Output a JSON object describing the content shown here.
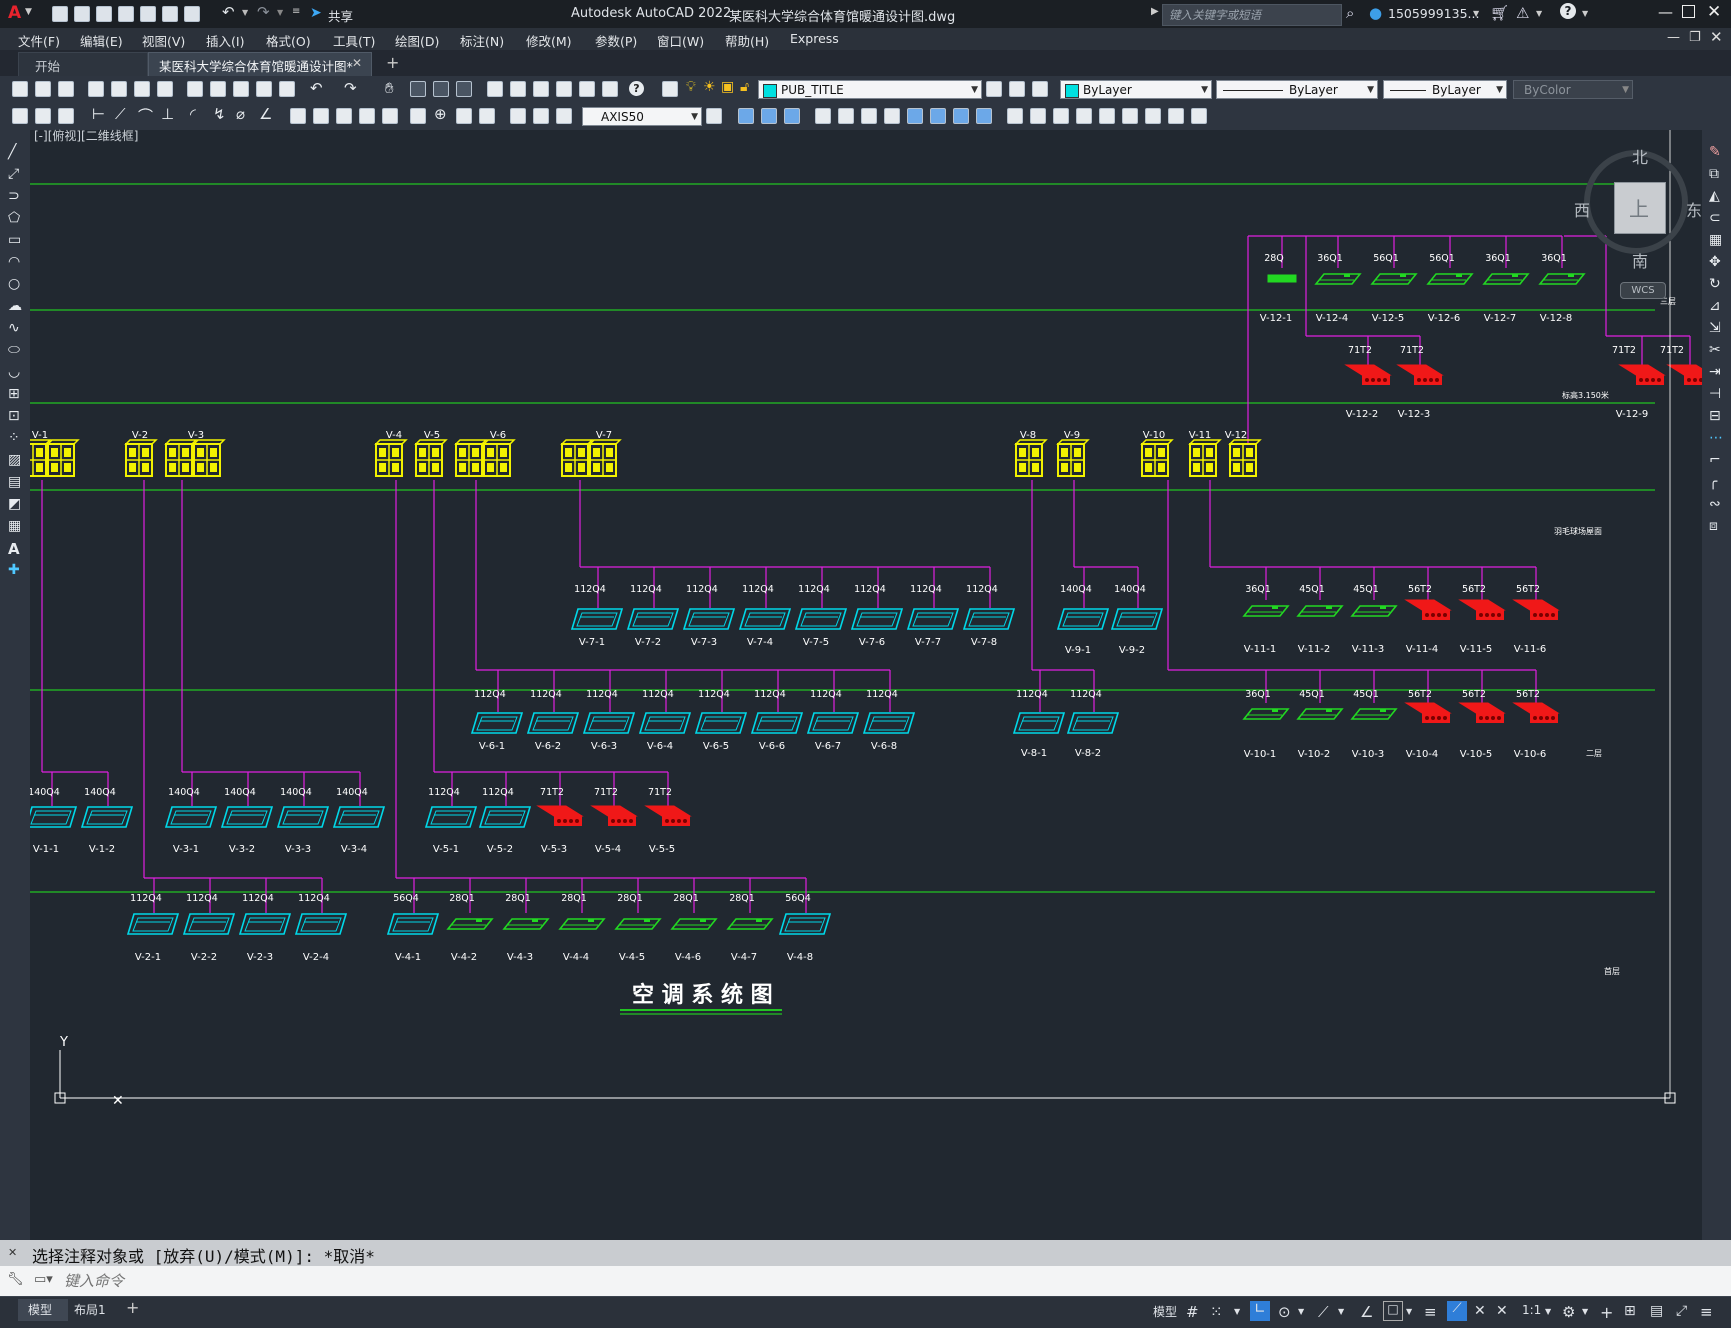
{
  "app": {
    "title": "Autodesk AutoCAD 2022",
    "file": "某医科大学综合体育馆暖通设计图.dwg",
    "share": "共享",
    "search_placeholder": "键入关键字或短语",
    "user": "1505999135...",
    "logo": "A"
  },
  "menu": [
    "文件(F)",
    "编辑(E)",
    "视图(V)",
    "插入(I)",
    "格式(O)",
    "工具(T)",
    "绘图(D)",
    "标注(N)",
    "修改(M)",
    "参数(P)",
    "窗口(W)",
    "帮助(H)",
    "Express"
  ],
  "tabs": [
    {
      "label": "开始",
      "active": false
    },
    {
      "label": "某医科大学综合体育馆暖通设计图*",
      "active": true
    }
  ],
  "toolbar": {
    "layer": "PUB_TITLE",
    "color": "ByLayer",
    "linetype": "ByLayer",
    "lineweight": "ByLayer",
    "plotstyle": "ByColor",
    "dimstyle": "AXIS50"
  },
  "viewport_label": "[-][俯视][二维线框]",
  "viewcube": {
    "north": "北",
    "south": "南",
    "east": "东",
    "west": "西",
    "top": "上",
    "wcs": "WCS"
  },
  "drawing": {
    "title": "空 调 系 统 图",
    "level_labels": [
      "三层",
      "标高3.150米",
      "羽毛球场屋面",
      "二层",
      "首层"
    ],
    "risers": [
      "V-1",
      "V-2",
      "V-3",
      "V-4",
      "V-5",
      "V-6",
      "V-7",
      "V-8",
      "V-9",
      "V-10",
      "V-11",
      "V-12"
    ],
    "row_v7": {
      "specs": [
        "112Q4",
        "112Q4",
        "112Q4",
        "112Q4",
        "112Q4",
        "112Q4",
        "112Q4",
        "112Q4"
      ],
      "units": [
        "V-7-1",
        "V-7-2",
        "V-7-3",
        "V-7-4",
        "V-7-5",
        "V-7-6",
        "V-7-7",
        "V-7-8"
      ]
    },
    "row_v6": {
      "specs": [
        "112Q4",
        "112Q4",
        "112Q4",
        "112Q4",
        "112Q4",
        "112Q4",
        "112Q4",
        "112Q4"
      ],
      "units": [
        "V-6-1",
        "V-6-2",
        "V-6-3",
        "V-6-4",
        "V-6-5",
        "V-6-6",
        "V-6-7",
        "V-6-8"
      ]
    },
    "row_v9": {
      "specs": [
        "140Q4",
        "140Q4"
      ],
      "units": [
        "V-9-1",
        "V-9-2"
      ]
    },
    "row_v8": {
      "specs": [
        "112Q4",
        "112Q4"
      ],
      "units": [
        "V-8-1",
        "V-8-2"
      ]
    },
    "row_v11": {
      "specs": [
        "36Q1",
        "45Q1",
        "45Q1",
        "56T2",
        "56T2",
        "56T2"
      ],
      "units": [
        "V-11-1",
        "V-11-2",
        "V-11-3",
        "V-11-4",
        "V-11-5",
        "V-11-6"
      ]
    },
    "row_v10": {
      "specs": [
        "36Q1",
        "45Q1",
        "45Q1",
        "56T2",
        "56T2",
        "56T2"
      ],
      "units": [
        "V-10-1",
        "V-10-2",
        "V-10-3",
        "V-10-4",
        "V-10-5",
        "V-10-6"
      ]
    },
    "row_v12a": {
      "specs": [
        "28Q",
        "36Q1",
        "56Q1",
        "56Q1",
        "36Q1",
        "36Q1"
      ],
      "units": [
        "V-12-1",
        "V-12-4",
        "V-12-5",
        "V-12-6",
        "V-12-7",
        "V-12-8"
      ]
    },
    "row_v12b": {
      "specs": [
        "71T2",
        "71T2"
      ],
      "units": [
        "V-12-2",
        "V-12-3"
      ]
    },
    "row_v12c": {
      "specs": [
        "71T2",
        "71T2"
      ],
      "units": [
        "V-12-9"
      ]
    },
    "row_v1": {
      "specs": [
        "140Q4",
        "140Q4"
      ],
      "units": [
        "V-1-1",
        "V-1-2"
      ]
    },
    "row_v3": {
      "specs": [
        "140Q4",
        "140Q4",
        "140Q4",
        "140Q4"
      ],
      "units": [
        "V-3-1",
        "V-3-2",
        "V-3-3",
        "V-3-4"
      ]
    },
    "row_v5": {
      "specs": [
        "112Q4",
        "112Q4",
        "71T2",
        "71T2",
        "71T2"
      ],
      "units": [
        "V-5-1",
        "V-5-2",
        "V-5-3",
        "V-5-4",
        "V-5-5"
      ]
    },
    "row_v2": {
      "specs": [
        "112Q4",
        "112Q4",
        "112Q4",
        "112Q4"
      ],
      "units": [
        "V-2-1",
        "V-2-2",
        "V-2-3",
        "V-2-4"
      ]
    },
    "row_v4": {
      "specs": [
        "56Q4",
        "28Q1",
        "28Q1",
        "28Q1",
        "28Q1",
        "28Q1",
        "28Q1",
        "56Q4"
      ],
      "units": [
        "V-4-1",
        "V-4-2",
        "V-4-3",
        "V-4-4",
        "V-4-5",
        "V-4-6",
        "V-4-7",
        "V-4-8"
      ]
    },
    "ucs": {
      "y": "Y"
    }
  },
  "command": {
    "history": "选择注释对象或 [放弃(U)/模式(M)]: *取消*",
    "placeholder": "键入命令"
  },
  "status": {
    "layout_tabs": [
      "模型",
      "布局1"
    ],
    "model": "模型",
    "scale": "1:1"
  },
  "colors": {
    "bg": "#212830",
    "level_line": "#22c322",
    "pipe": "#e020e0",
    "cyan_unit": "#00d8e8",
    "green_unit": "#22d822",
    "red_unit": "#f01818",
    "yellow_unit": "#f2f200"
  }
}
